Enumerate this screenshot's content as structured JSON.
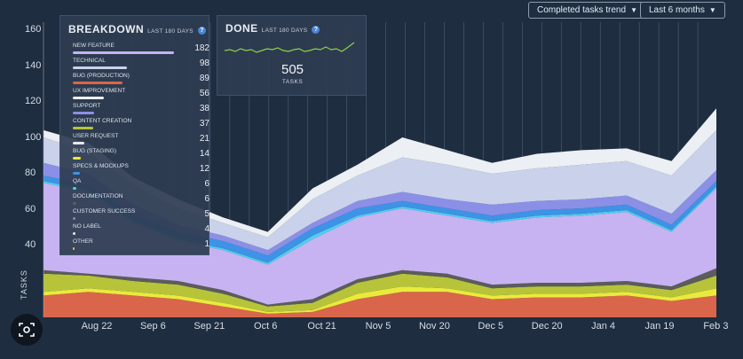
{
  "controls": {
    "trend_dropdown": "Completed tasks trend",
    "range_dropdown": "Last 6 months"
  },
  "breakdown": {
    "title": "BREAKDOWN",
    "subtitle": "LAST 180 DAYS",
    "help": "?",
    "items": [
      {
        "label": "NEW FEATURE",
        "value": 182,
        "color": "#c7b3f2"
      },
      {
        "label": "TECHNICAL",
        "value": 98,
        "color": "#c9d2ea"
      },
      {
        "label": "BUG (PRODUCTION)",
        "value": 89,
        "color": "#d9664a"
      },
      {
        "label": "UX IMPROVEMENT",
        "value": 56,
        "color": "#eceff3"
      },
      {
        "label": "SUPPORT",
        "value": 38,
        "color": "#8c8fe6"
      },
      {
        "label": "CONTENT CREATION",
        "value": 37,
        "color": "#b7c43a"
      },
      {
        "label": "USER REQUEST",
        "value": 21,
        "color": "#e8e8ea"
      },
      {
        "label": "BUG (STAGING)",
        "value": 14,
        "color": "#eaea3c"
      },
      {
        "label": "SPECS & MOCKUPS",
        "value": 12,
        "color": "#3d93e6"
      },
      {
        "label": "QA",
        "value": 6,
        "color": "#4fd0ec"
      },
      {
        "label": "DOCUMENTATION",
        "value": 6,
        "color": "#5c5c5c"
      },
      {
        "label": "CUSTOMER SUCCESS",
        "value": 5,
        "color": "#8a8f96"
      },
      {
        "label": "NO LABEL",
        "value": 4,
        "color": "#e6e9ee"
      },
      {
        "label": "OTHER",
        "value": 1,
        "color": "#f0c23a"
      }
    ]
  },
  "done": {
    "title": "DONE",
    "subtitle": "LAST 180 DAYS",
    "help": "?",
    "value": "505",
    "unit": "TASKS",
    "spark_color": "#8bd14b"
  },
  "chart_data": {
    "type": "area",
    "ylabel": "TASKS",
    "ylim": [
      0,
      160
    ],
    "yticks": [
      40,
      60,
      80,
      100,
      120,
      140,
      160
    ],
    "xticks": [
      "Aug 22",
      "Sep 6",
      "Sep 21",
      "Oct 6",
      "Oct 21",
      "Nov 5",
      "Nov 20",
      "Dec 5",
      "Dec 20",
      "Jan 4",
      "Jan 19",
      "Feb 3"
    ],
    "series": [
      {
        "name": "BUG (PRODUCTION)",
        "color": "#d9664a",
        "values": [
          12,
          14,
          12,
          10,
          6,
          2,
          3,
          10,
          14,
          14,
          10,
          11,
          11,
          12,
          9,
          12
        ]
      },
      {
        "name": "BUG (STAGING)",
        "color": "#eaea3c",
        "values": [
          2,
          2,
          2,
          2,
          2,
          1,
          1,
          3,
          3,
          2,
          2,
          2,
          2,
          2,
          2,
          4
        ]
      },
      {
        "name": "CONTENT CREATION",
        "color": "#b7c43a",
        "values": [
          10,
          7,
          6,
          6,
          5,
          3,
          4,
          6,
          7,
          6,
          4,
          4,
          4,
          4,
          4,
          7
        ]
      },
      {
        "name": "DOCUMENTATION",
        "color": "#5c5c5c",
        "values": [
          2,
          1,
          2,
          2,
          2,
          1,
          2,
          2,
          2,
          2,
          2,
          2,
          2,
          2,
          2,
          4
        ]
      },
      {
        "name": "NEW FEATURE",
        "color": "#c7b3f2",
        "values": [
          48,
          45,
          30,
          22,
          22,
          22,
          33,
          34,
          34,
          32,
          34,
          36,
          37,
          38,
          30,
          44
        ]
      },
      {
        "name": "QA",
        "color": "#4fd0ec",
        "values": [
          1,
          1,
          1,
          1,
          1,
          1,
          2,
          1,
          1,
          1,
          1,
          1,
          1,
          1,
          1,
          1
        ]
      },
      {
        "name": "SPECS & MOCKUPS",
        "color": "#3d93e6",
        "values": [
          3,
          3,
          4,
          4,
          4,
          4,
          4,
          4,
          3,
          3,
          3,
          3,
          3,
          3,
          3,
          3
        ]
      },
      {
        "name": "SUPPORT",
        "color": "#8c8fe6",
        "values": [
          7,
          6,
          5,
          4,
          3,
          3,
          3,
          4,
          5,
          5,
          6,
          5,
          5,
          5,
          6,
          6
        ]
      },
      {
        "name": "TECHNICAL",
        "color": "#c9d2ea",
        "values": [
          14,
          12,
          11,
          9,
          7,
          7,
          13,
          14,
          19,
          19,
          17,
          18,
          19,
          19,
          21,
          22
        ]
      },
      {
        "name": "UX IMPROVEMENT",
        "color": "#eceff3",
        "values": [
          4,
          5,
          4,
          5,
          3,
          3,
          6,
          6,
          11,
          8,
          6,
          8,
          8,
          7,
          8,
          12
        ]
      }
    ]
  }
}
